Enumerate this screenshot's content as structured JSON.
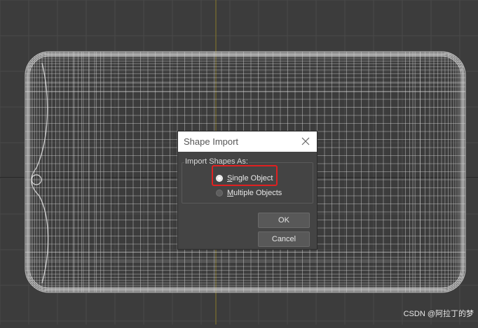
{
  "dialog": {
    "title": "Shape Import",
    "group_label": "Import Shapes As:",
    "options": [
      {
        "label_first": "S",
        "label_rest": "ingle Object",
        "selected": true
      },
      {
        "label_first": "M",
        "label_rest": "ultiple Objects",
        "selected": false
      }
    ],
    "ok_label": "OK",
    "cancel_label": "Cancel"
  },
  "watermark": "CSDN @阿拉丁的梦",
  "colors": {
    "viewport_bg": "#3c3c3c",
    "wireframe": "#d8d8d8",
    "grid": "#4a4a4a",
    "axis": "#8a7a2a",
    "highlight": "#e02020"
  }
}
